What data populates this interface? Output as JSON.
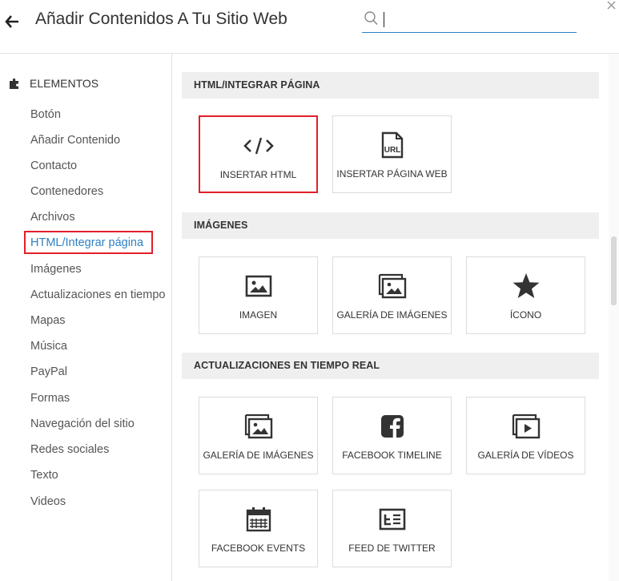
{
  "header": {
    "title": "Añadir Contenidos A Tu Sitio Web",
    "search_value": "",
    "search_placeholder": ""
  },
  "sidebar": {
    "category": "ELEMENTOS",
    "items": [
      {
        "label": "Botón"
      },
      {
        "label": "Añadir Contenido"
      },
      {
        "label": "Contacto"
      },
      {
        "label": "Contenedores"
      },
      {
        "label": "Archivos"
      },
      {
        "label": "HTML/Integrar página",
        "active": true
      },
      {
        "label": "Imágenes"
      },
      {
        "label": "Actualizaciones en tiempo"
      },
      {
        "label": "Mapas"
      },
      {
        "label": "Música"
      },
      {
        "label": "PayPal"
      },
      {
        "label": "Formas"
      },
      {
        "label": "Navegación del sitio"
      },
      {
        "label": "Redes sociales"
      },
      {
        "label": "Texto"
      },
      {
        "label": "Videos"
      }
    ]
  },
  "sections": [
    {
      "title": "HTML/INTEGRAR PÁGINA",
      "tiles": [
        {
          "label": "INSERTAR HTML",
          "icon": "code-icon",
          "selected": true
        },
        {
          "label": "INSERTAR PÁGINA WEB",
          "icon": "url-page-icon"
        }
      ]
    },
    {
      "title": "IMÁGENES",
      "tiles": [
        {
          "label": "IMAGEN",
          "icon": "image-icon"
        },
        {
          "label": "GALERÍA DE IMÁGENES",
          "icon": "gallery-icon"
        },
        {
          "label": "ÍCONO",
          "icon": "star-icon"
        }
      ]
    },
    {
      "title": "ACTUALIZACIONES EN TIEMPO REAL",
      "tiles": [
        {
          "label": "GALERÍA DE IMÁGENES",
          "icon": "gallery-icon"
        },
        {
          "label": "FACEBOOK TIMELINE",
          "icon": "facebook-icon"
        },
        {
          "label": "GALERÍA DE VÍDEOS",
          "icon": "video-gallery-icon"
        },
        {
          "label": "FACEBOOK EVENTS",
          "icon": "calendar-icon"
        },
        {
          "label": "FEED DE TWITTER",
          "icon": "feed-icon"
        }
      ]
    }
  ],
  "colors": {
    "accent": "#2f80c2",
    "highlight": "#e2202a",
    "section_bg": "#efefef"
  }
}
